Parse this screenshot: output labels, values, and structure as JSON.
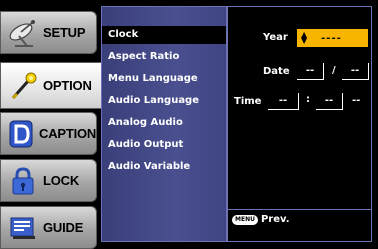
{
  "sidebar": {
    "items": [
      {
        "label": "SETUP",
        "icon": "satellite-dish-icon"
      },
      {
        "label": "OPTION",
        "icon": "magic-wand-icon"
      },
      {
        "label": "CAPTION",
        "icon": "caption-d-icon"
      },
      {
        "label": "LOCK",
        "icon": "padlock-icon"
      },
      {
        "label": "GUIDE",
        "icon": "guide-icon"
      }
    ],
    "active": "OPTION"
  },
  "menu": {
    "items": [
      "Clock",
      "Aspect Ratio",
      "Menu Language",
      "Audio Language",
      "Analog Audio",
      "Audio Output",
      "Audio Variable"
    ],
    "selected": "Clock"
  },
  "clock": {
    "year_label": "Year",
    "year_value": "----",
    "date_label": "Date",
    "date_month": "--",
    "date_sep": "/",
    "date_day": "--",
    "time_label": "Time",
    "time_hour": "--",
    "time_sep": ":",
    "time_min": "--",
    "time_ampm": "--"
  },
  "footer": {
    "key": "MENU",
    "label": "Prev."
  },
  "colors": {
    "highlight": "#f7b500",
    "menu_bg": "#44498a",
    "accent_border": "#6d72b5"
  }
}
